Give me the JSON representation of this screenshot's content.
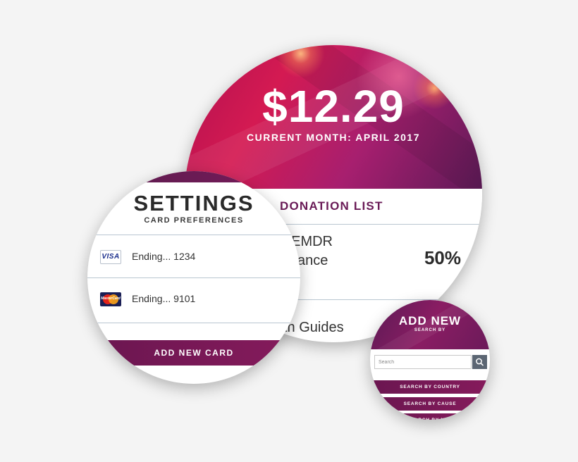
{
  "donation": {
    "amount": "$12.29",
    "month_label": "CURRENT MONTH: APRIL 2017",
    "list_header": "DONATION LIST",
    "rows": [
      {
        "name_line1": ", EMDR",
        "name_line2": "istance",
        "percent": "50%"
      },
      {
        "name_line1": "th Guides"
      }
    ]
  },
  "settings": {
    "title": "SETTINGS",
    "subtitle": "CARD PREFERENCES",
    "cards": [
      {
        "brand": "VISA",
        "label": "Ending... 1234",
        "icon": "visa-card-icon"
      },
      {
        "brand": "MasterCard",
        "label": "Ending... 9101",
        "icon": "mastercard-icon"
      }
    ],
    "add_button": "ADD NEW CARD"
  },
  "search": {
    "title": "ADD NEW",
    "subtitle": "SEARCH BY",
    "placeholder": "Search",
    "buttons": [
      "SEARCH BY COUNTRY",
      "SEARCH BY CAUSE",
      "SEARCH BY NON"
    ]
  },
  "colors": {
    "accent": "#7a1a5b",
    "hero_pink": "#d41a52",
    "divider": "#b9c6d1"
  }
}
